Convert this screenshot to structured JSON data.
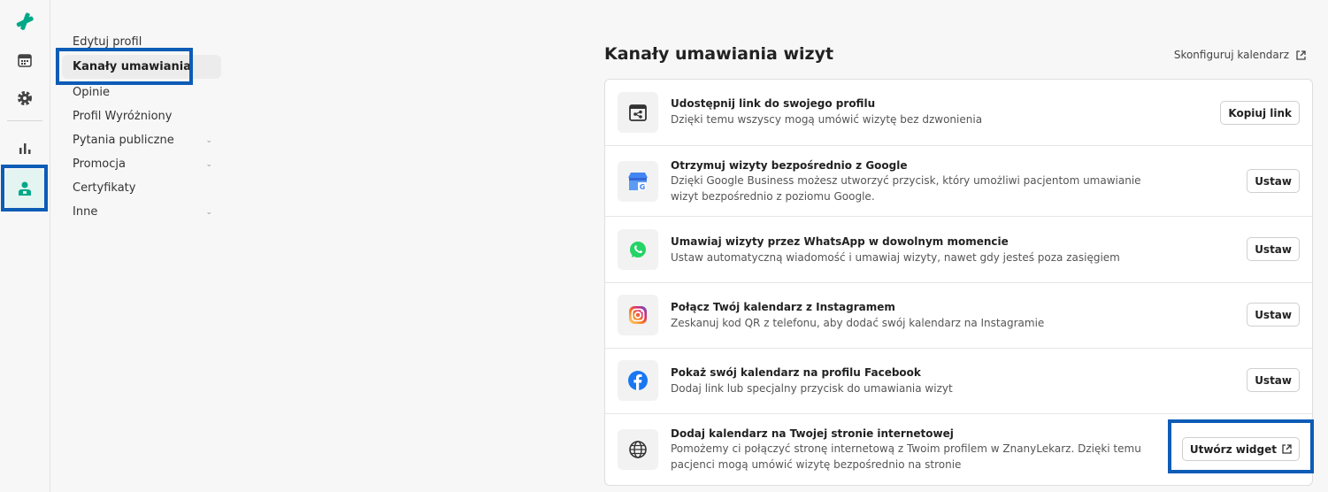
{
  "rail": {
    "items": [
      "logo-icon",
      "calendar-icon",
      "settings-icon",
      "stats-icon",
      "profile-icon"
    ]
  },
  "nav": {
    "items": [
      {
        "label": "Edytuj profil"
      },
      {
        "label": "Kanały umawiania"
      },
      {
        "label": "Opinie"
      },
      {
        "label": "Profil Wyróżniony"
      },
      {
        "label": "Pytania publiczne"
      },
      {
        "label": "Promocja"
      },
      {
        "label": "Certyfikaty"
      },
      {
        "label": "Inne"
      }
    ],
    "active": "Kanały umawiania"
  },
  "header": {
    "title": "Kanały umawiania wizyt",
    "configure_label": "Skonfiguruj kalendarz"
  },
  "channels": [
    {
      "icon": "share-calendar-icon",
      "title": "Udostępnij link do swojego profilu",
      "desc": "Dzięki temu wszyscy mogą umówić wizytę bez dzwonienia",
      "button": "Kopiuj link"
    },
    {
      "icon": "google-business-icon",
      "title": "Otrzymuj wizyty bezpośrednio z Google",
      "desc": "Dzięki Google Business możesz utworzyć przycisk, który umożliwi pacjentom umawianie wizyt bezpośrednio z poziomu Google.",
      "button": "Ustaw"
    },
    {
      "icon": "whatsapp-icon",
      "title": "Umawiaj wizyty przez WhatsApp w dowolnym momencie",
      "desc": "Ustaw automatyczną wiadomość i umawiaj wizyty, nawet gdy jesteś poza zasięgiem",
      "button": "Ustaw"
    },
    {
      "icon": "instagram-icon",
      "title": "Połącz Twój kalendarz z Instagramem",
      "desc": "Zeskanuj kod QR z telefonu, aby dodać swój kalendarz na Instagramie",
      "button": "Ustaw"
    },
    {
      "icon": "facebook-icon",
      "title": "Pokaż swój kalendarz na profilu Facebook",
      "desc": "Dodaj link lub specjalny przycisk do umawiania wizyt",
      "button": "Ustaw"
    },
    {
      "icon": "globe-icon",
      "title": "Dodaj kalendarz na Twojej stronie internetowej",
      "desc": "Pomożemy ci połączyć stronę internetową z Twoim profilem w ZnanyLekarz. Dzięki temu pacjenci mogą umówić wizytę bezpośrednio na stronie",
      "button": "Utwórz widget"
    }
  ],
  "colors": {
    "brand": "#00a888",
    "highlight": "#0d5cb6"
  }
}
